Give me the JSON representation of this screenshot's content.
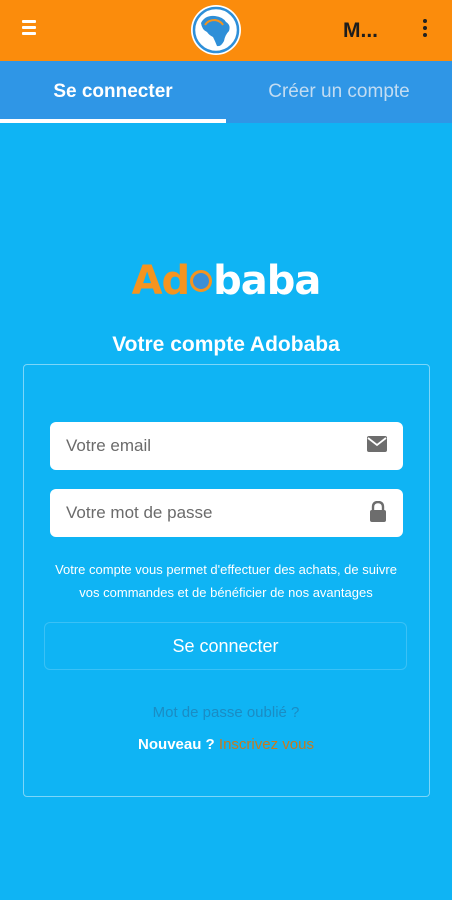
{
  "appbar": {
    "title": "M...",
    "menu_icon": "hamburger-menu-icon",
    "logo_icon": "africa-globe-logo",
    "more_icon": "more-vertical-icon"
  },
  "tabs": [
    {
      "label": "Se connecter",
      "active": true
    },
    {
      "label": "Créer un compte",
      "active": false
    }
  ],
  "brand": {
    "part1": "Ad",
    "part2": "baba"
  },
  "page_title": "Votre compte Adobaba",
  "form": {
    "email_placeholder": "Votre email",
    "email_icon": "envelope-icon",
    "password_placeholder": "Votre mot de passe",
    "password_icon": "lock-icon",
    "info_line1": "Votre compte vous permet d'effectuer des achats, de suivre",
    "info_line2": "vos commandes et de bénéficier de nos avantages",
    "submit_label": "Se connecter",
    "forgot_label": "Mot de passe oublié ?",
    "new_label": "Nouveau ?",
    "signup_label": "Inscrivez vous"
  },
  "colors": {
    "appbar": "#fb8c0c",
    "tabs": "#2f96e6",
    "background": "#0fb4f4",
    "brand_orange": "#f5941f"
  }
}
